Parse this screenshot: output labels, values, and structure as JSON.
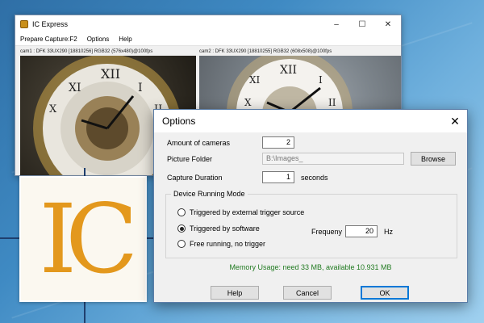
{
  "main_window": {
    "title": "IC Express",
    "menu": [
      "Prepare Capture:F2",
      "Options",
      "Help"
    ],
    "window_controls": [
      "minimize-icon",
      "maximize-icon",
      "close-icon"
    ],
    "cameras": [
      {
        "label": "cam1 : DFK 33UX290 [18810256] RGB32 (576x480)@100fps"
      },
      {
        "label": "cam2 : DFK 33UX290 [18810255] RGB32 (608x508)@100fps"
      }
    ]
  },
  "logo": {
    "text": "IC",
    "color": "#e3981d"
  },
  "options_dialog": {
    "title": "Options",
    "amount_label": "Amount of cameras",
    "amount_value": "2",
    "folder_label": "Picture Folder",
    "folder_value": "B:\\Images_",
    "browse_label": "Browse",
    "duration_label": "Capture Duration",
    "duration_value": "1",
    "duration_unit": "seconds",
    "group_title": "Device Running Mode",
    "modes": [
      {
        "label": "Triggered by external trigger source",
        "selected": false
      },
      {
        "label": "Triggered by software",
        "selected": true
      },
      {
        "label": "Free running, no trigger",
        "selected": false
      }
    ],
    "frequency_label": "Frequeny",
    "frequency_value": "20",
    "frequency_unit": "Hz",
    "memory_text": "Memory Usage: need 33 MB, available 10.931 MB",
    "help_label": "Help",
    "cancel_label": "Cancel",
    "ok_label": "OK"
  },
  "colors": {
    "accent": "#0078d7",
    "memory_text": "#217b21",
    "logo_orange": "#e3981d"
  }
}
